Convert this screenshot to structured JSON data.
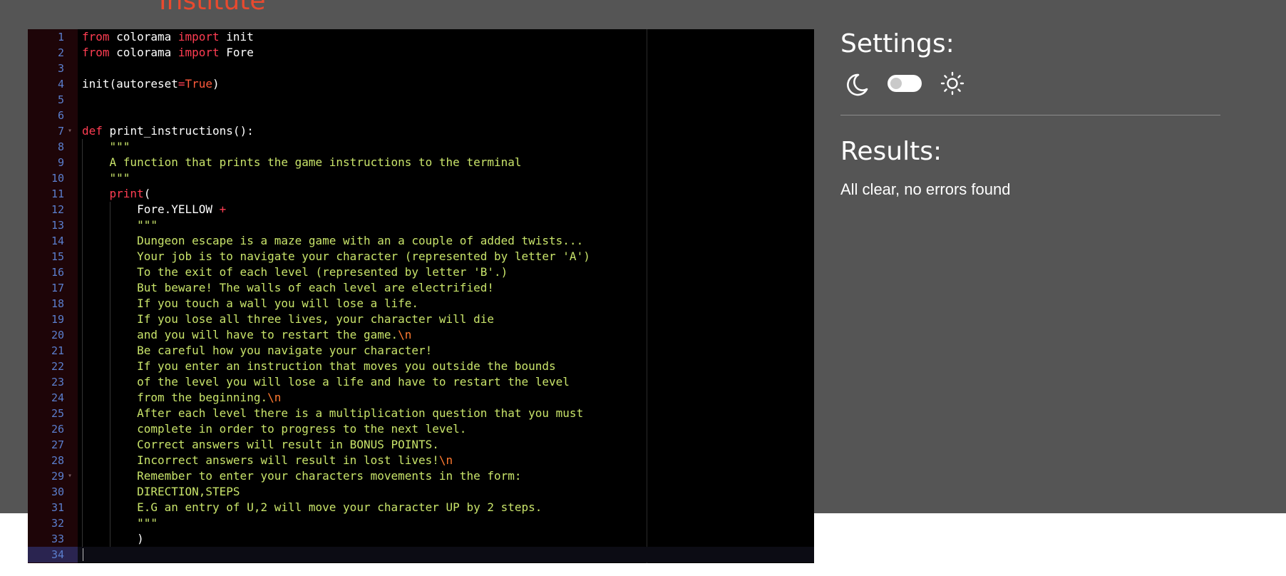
{
  "header": {
    "logo_text": "Institute"
  },
  "editor": {
    "active_line": 34,
    "lines": [
      {
        "n": "1",
        "fold": "",
        "tokens": [
          {
            "t": "from",
            "c": "k"
          },
          {
            "t": " colorama ",
            "c": ""
          },
          {
            "t": "import",
            "c": "k"
          },
          {
            "t": " init",
            "c": ""
          }
        ]
      },
      {
        "n": "2",
        "fold": "",
        "tokens": [
          {
            "t": "from",
            "c": "k"
          },
          {
            "t": " colorama ",
            "c": ""
          },
          {
            "t": "import",
            "c": "k"
          },
          {
            "t": " Fore",
            "c": ""
          }
        ]
      },
      {
        "n": "3",
        "fold": "",
        "tokens": []
      },
      {
        "n": "4",
        "fold": "",
        "tokens": [
          {
            "t": "init(autoreset",
            "c": ""
          },
          {
            "t": "=",
            "c": "o"
          },
          {
            "t": "True",
            "c": "b"
          },
          {
            "t": ")",
            "c": ""
          }
        ]
      },
      {
        "n": "5",
        "fold": "",
        "tokens": []
      },
      {
        "n": "6",
        "fold": "",
        "tokens": []
      },
      {
        "n": "7",
        "fold": "▾",
        "tokens": [
          {
            "t": "def",
            "c": "k"
          },
          {
            "t": " print_instructions():",
            "c": ""
          }
        ]
      },
      {
        "n": "8",
        "fold": "",
        "tokens": [
          {
            "t": "    \"\"\"",
            "c": "s"
          }
        ]
      },
      {
        "n": "9",
        "fold": "",
        "tokens": [
          {
            "t": "    A function that prints the game instructions to the terminal",
            "c": "s"
          }
        ]
      },
      {
        "n": "10",
        "fold": "",
        "tokens": [
          {
            "t": "    \"\"\"",
            "c": "s"
          }
        ]
      },
      {
        "n": "11",
        "fold": "",
        "tokens": [
          {
            "t": "    ",
            "c": ""
          },
          {
            "t": "print",
            "c": "k"
          },
          {
            "t": "(",
            "c": ""
          }
        ]
      },
      {
        "n": "12",
        "fold": "",
        "tokens": [
          {
            "t": "        Fore.YELLOW ",
            "c": ""
          },
          {
            "t": "+",
            "c": "o"
          }
        ]
      },
      {
        "n": "13",
        "fold": "",
        "tokens": [
          {
            "t": "        \"\"\"",
            "c": "s"
          }
        ]
      },
      {
        "n": "14",
        "fold": "",
        "tokens": [
          {
            "t": "        Dungeon escape is a maze game with an a couple of added twists...",
            "c": "s"
          }
        ]
      },
      {
        "n": "15",
        "fold": "",
        "tokens": [
          {
            "t": "        Your job is to navigate your character (represented by letter 'A')",
            "c": "s"
          }
        ]
      },
      {
        "n": "16",
        "fold": "",
        "tokens": [
          {
            "t": "        To the exit of each level (represented by letter 'B'.)",
            "c": "s"
          }
        ]
      },
      {
        "n": "17",
        "fold": "",
        "tokens": [
          {
            "t": "        But beware! The walls of each level are electrified!",
            "c": "s"
          }
        ]
      },
      {
        "n": "18",
        "fold": "",
        "tokens": [
          {
            "t": "        If you touch a wall you will lose a life.",
            "c": "s"
          }
        ]
      },
      {
        "n": "19",
        "fold": "",
        "tokens": [
          {
            "t": "        If you lose all three lives, your character will die",
            "c": "s"
          }
        ]
      },
      {
        "n": "20",
        "fold": "",
        "tokens": [
          {
            "t": "        and you will have to restart the game.",
            "c": "s"
          },
          {
            "t": "\\n",
            "c": "e"
          }
        ]
      },
      {
        "n": "21",
        "fold": "",
        "tokens": [
          {
            "t": "        Be careful how you navigate your character!",
            "c": "s"
          }
        ]
      },
      {
        "n": "22",
        "fold": "",
        "tokens": [
          {
            "t": "        If you enter an instruction that moves you outside the bounds",
            "c": "s"
          }
        ]
      },
      {
        "n": "23",
        "fold": "",
        "tokens": [
          {
            "t": "        of the level you will lose a life and have to restart the level",
            "c": "s"
          }
        ]
      },
      {
        "n": "24",
        "fold": "",
        "tokens": [
          {
            "t": "        from the beginning.",
            "c": "s"
          },
          {
            "t": "\\n",
            "c": "e"
          }
        ]
      },
      {
        "n": "25",
        "fold": "",
        "tokens": [
          {
            "t": "        After each level there is a multiplication question that you must",
            "c": "s"
          }
        ]
      },
      {
        "n": "26",
        "fold": "",
        "tokens": [
          {
            "t": "        complete in order to progress to the next level.",
            "c": "s"
          }
        ]
      },
      {
        "n": "27",
        "fold": "",
        "tokens": [
          {
            "t": "        Correct answers will result in BONUS POINTS.",
            "c": "s"
          }
        ]
      },
      {
        "n": "28",
        "fold": "",
        "tokens": [
          {
            "t": "        Incorrect answers will result in lost lives!",
            "c": "s"
          },
          {
            "t": "\\n",
            "c": "e"
          }
        ]
      },
      {
        "n": "29",
        "fold": "▾",
        "tokens": [
          {
            "t": "        Remember to enter your characters movements in the form:",
            "c": "s"
          }
        ]
      },
      {
        "n": "30",
        "fold": "",
        "tokens": [
          {
            "t": "        DIRECTION,STEPS",
            "c": "s"
          }
        ]
      },
      {
        "n": "31",
        "fold": "",
        "tokens": [
          {
            "t": "        E.G an entry of U,2 will move your character UP by 2 steps.",
            "c": "s"
          }
        ]
      },
      {
        "n": "32",
        "fold": "",
        "tokens": [
          {
            "t": "        \"\"\"",
            "c": "s"
          }
        ]
      },
      {
        "n": "33",
        "fold": "",
        "tokens": [
          {
            "t": "        )",
            "c": ""
          }
        ]
      },
      {
        "n": "34",
        "fold": "",
        "tokens": []
      }
    ]
  },
  "settings": {
    "title": "Settings:",
    "dark_icon": "moon-icon",
    "light_icon": "sun-icon",
    "theme_toggle_on": false
  },
  "results": {
    "title": "Results:",
    "message": "All clear, no errors found"
  }
}
